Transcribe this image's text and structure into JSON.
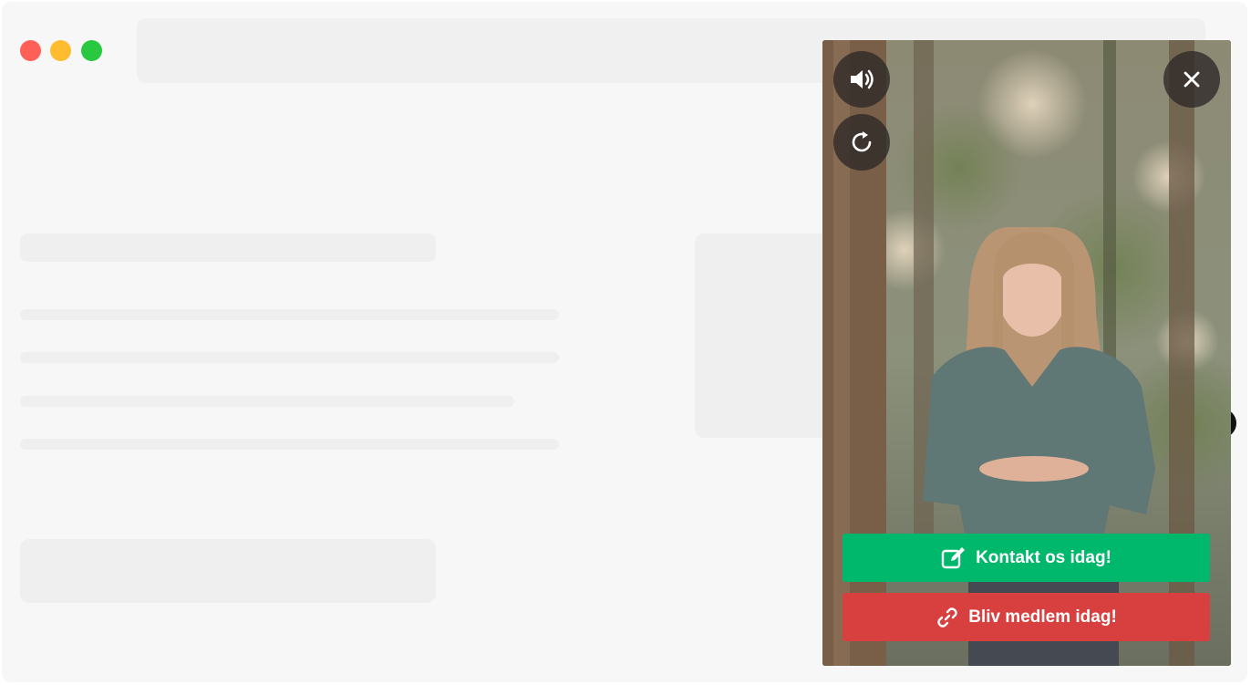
{
  "browser": {
    "traffic_lights": [
      "close",
      "minimize",
      "maximize"
    ]
  },
  "video_widget": {
    "sound_icon": "speaker-icon",
    "replay_icon": "replay-icon",
    "close_icon": "close-icon",
    "contact_button": {
      "label": "Kontakt os idag!",
      "icon": "edit-icon",
      "color": "#00b86b"
    },
    "member_button": {
      "label": "Bliv medlem idag!",
      "icon": "link-icon",
      "color": "#d84040"
    }
  }
}
